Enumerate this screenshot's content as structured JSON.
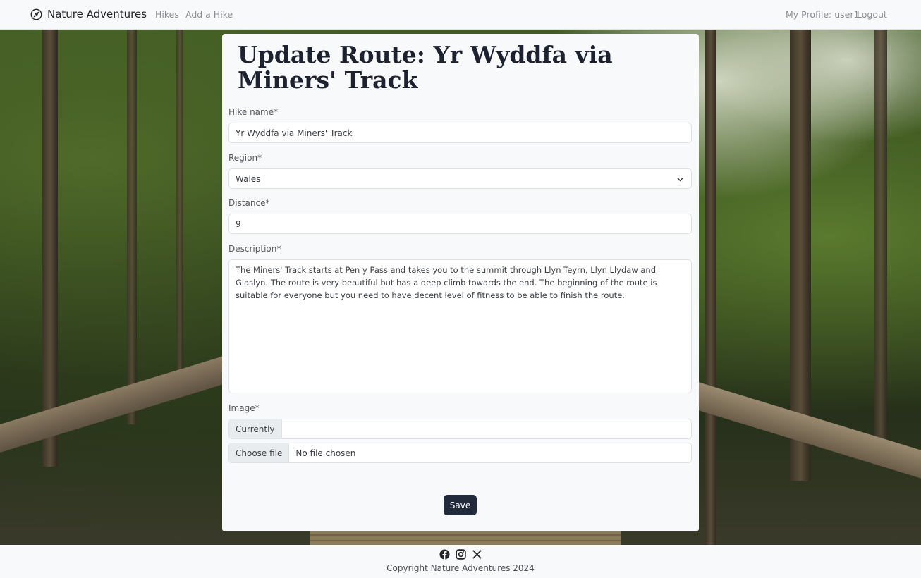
{
  "navbar": {
    "brand": "Nature Adventures",
    "links": [
      "Hikes",
      "Add a Hike"
    ],
    "profile": "My Profile: user1",
    "logout": "Logout"
  },
  "form": {
    "title": "Update Route: Yr Wyddfa via Miners' Track",
    "hike_name_label": "Hike name*",
    "hike_name_value": "Yr Wyddfa via Miners' Track",
    "region_label": "Region*",
    "region_value": "Wales",
    "distance_label": "Distance*",
    "distance_value": "9",
    "description_label": "Description*",
    "description_value": "The Miners' Track starts at Pen y Pass and takes you to the summit through Llyn Teyrn, Llyn Llydaw and Glaslyn. The route is very beautiful but has a deep climb towards the end. The beginning of the route is suitable for everyone but you need to have decent level of fitness to be able to finish the route.",
    "image_label": "Image*",
    "currently_label": "Currently",
    "currently_value": "",
    "choose_file_label": "Choose file",
    "no_file_text": "No file chosen",
    "save_label": "Save"
  },
  "footer": {
    "social_icons": [
      "facebook-icon",
      "instagram-icon",
      "x-icon"
    ],
    "copyright": "Copyright Nature Adventures 2024"
  }
}
